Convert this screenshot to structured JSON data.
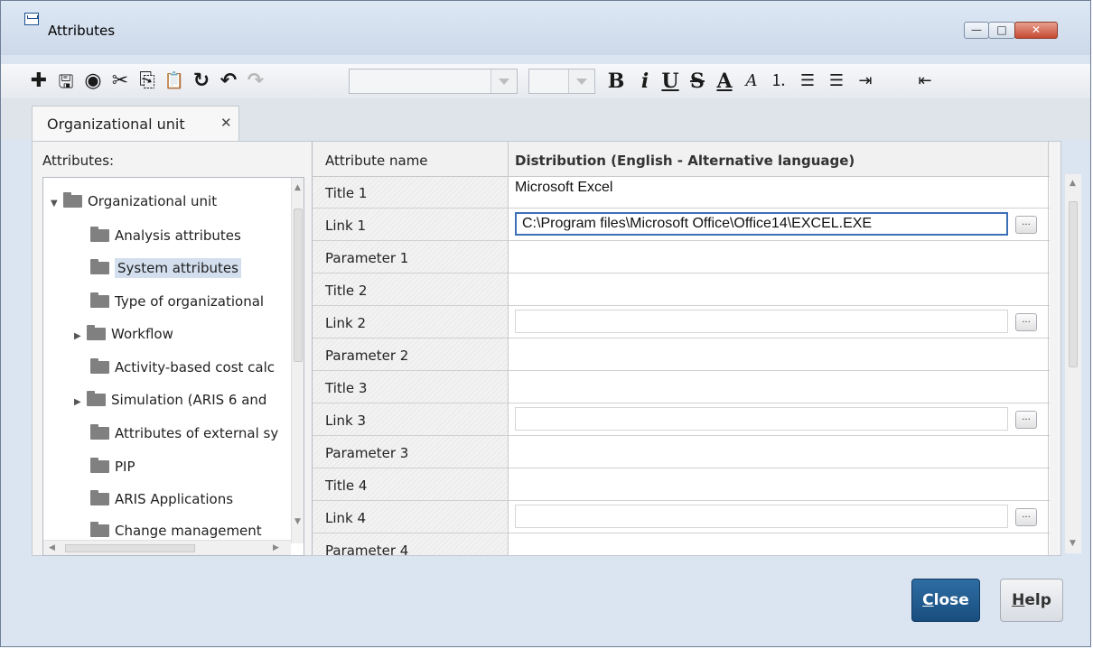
{
  "window": {
    "title": "Attributes",
    "minimize_glyph": "—",
    "maximize_glyph": "□",
    "close_glyph": "✕"
  },
  "toolbar": {
    "icons": [
      {
        "name": "add-icon",
        "glyph": "✚"
      },
      {
        "name": "save-icon",
        "glyph": "🖫"
      },
      {
        "name": "web-icon",
        "glyph": "◉"
      },
      {
        "name": "cut-icon",
        "glyph": "✂"
      },
      {
        "name": "copy-icon",
        "glyph": "⎘"
      },
      {
        "name": "paste-icon",
        "glyph": "📋"
      },
      {
        "name": "refresh-icon",
        "glyph": "↻"
      },
      {
        "name": "undo-icon",
        "glyph": "↶"
      },
      {
        "name": "redo-icon",
        "glyph": "↷"
      }
    ],
    "font_combo_value": "",
    "size_combo_value": "",
    "format": {
      "bold": "B",
      "italic": "i",
      "underline": "U",
      "strike": "S",
      "font_color": "A",
      "highlight": "A",
      "numbered_list": "⒈",
      "bullet_list": "☰",
      "indent": "⇥",
      "outdent": "⇤"
    }
  },
  "tab": {
    "label": "Organizational unit",
    "close_glyph": "✕"
  },
  "tree": {
    "header": "Attributes:",
    "items": [
      {
        "label": "Organizational unit",
        "expander": "▼"
      },
      {
        "label": "Analysis attributes",
        "expander": ""
      },
      {
        "label": "System attributes",
        "expander": ""
      },
      {
        "label": "Type of organizational",
        "expander": ""
      },
      {
        "label": "Workflow",
        "expander": "▶"
      },
      {
        "label": "Activity-based cost calc",
        "expander": ""
      },
      {
        "label": "Simulation (ARIS 6 and",
        "expander": "▶"
      },
      {
        "label": "Attributes of external sy",
        "expander": ""
      },
      {
        "label": "PIP",
        "expander": ""
      },
      {
        "label": "ARIS Applications",
        "expander": ""
      },
      {
        "label": "Change management",
        "expander": ""
      }
    ],
    "selected": "System attributes"
  },
  "grid": {
    "col_name_header": "Attribute name",
    "col_value_header": "Distribution (English - Alternative language)",
    "browse_label": "...",
    "rows": [
      {
        "name": "Title 1",
        "value": "Microsoft Excel"
      },
      {
        "name": "Link 1",
        "value": "C:\\Program files\\Microsoft Office\\Office14\\EXCEL.EXE"
      },
      {
        "name": "Parameter 1",
        "value": ""
      },
      {
        "name": "Title 2",
        "value": ""
      },
      {
        "name": "Link 2",
        "value": ""
      },
      {
        "name": "Parameter 2",
        "value": ""
      },
      {
        "name": "Title 3",
        "value": ""
      },
      {
        "name": "Link 3",
        "value": ""
      },
      {
        "name": "Parameter 3",
        "value": ""
      },
      {
        "name": "Title 4",
        "value": ""
      },
      {
        "name": "Link 4",
        "value": ""
      },
      {
        "name": "Parameter 4",
        "value": ""
      }
    ]
  },
  "footer": {
    "close_label": "Close",
    "close_mnemonic": "C",
    "close_rest": "lose",
    "help_mnemonic": "H",
    "help_rest": "elp"
  },
  "colors": {
    "primary_button": "#1f5b8f",
    "selection": "#d3dfee",
    "active_field_border": "#3d6fb6"
  }
}
